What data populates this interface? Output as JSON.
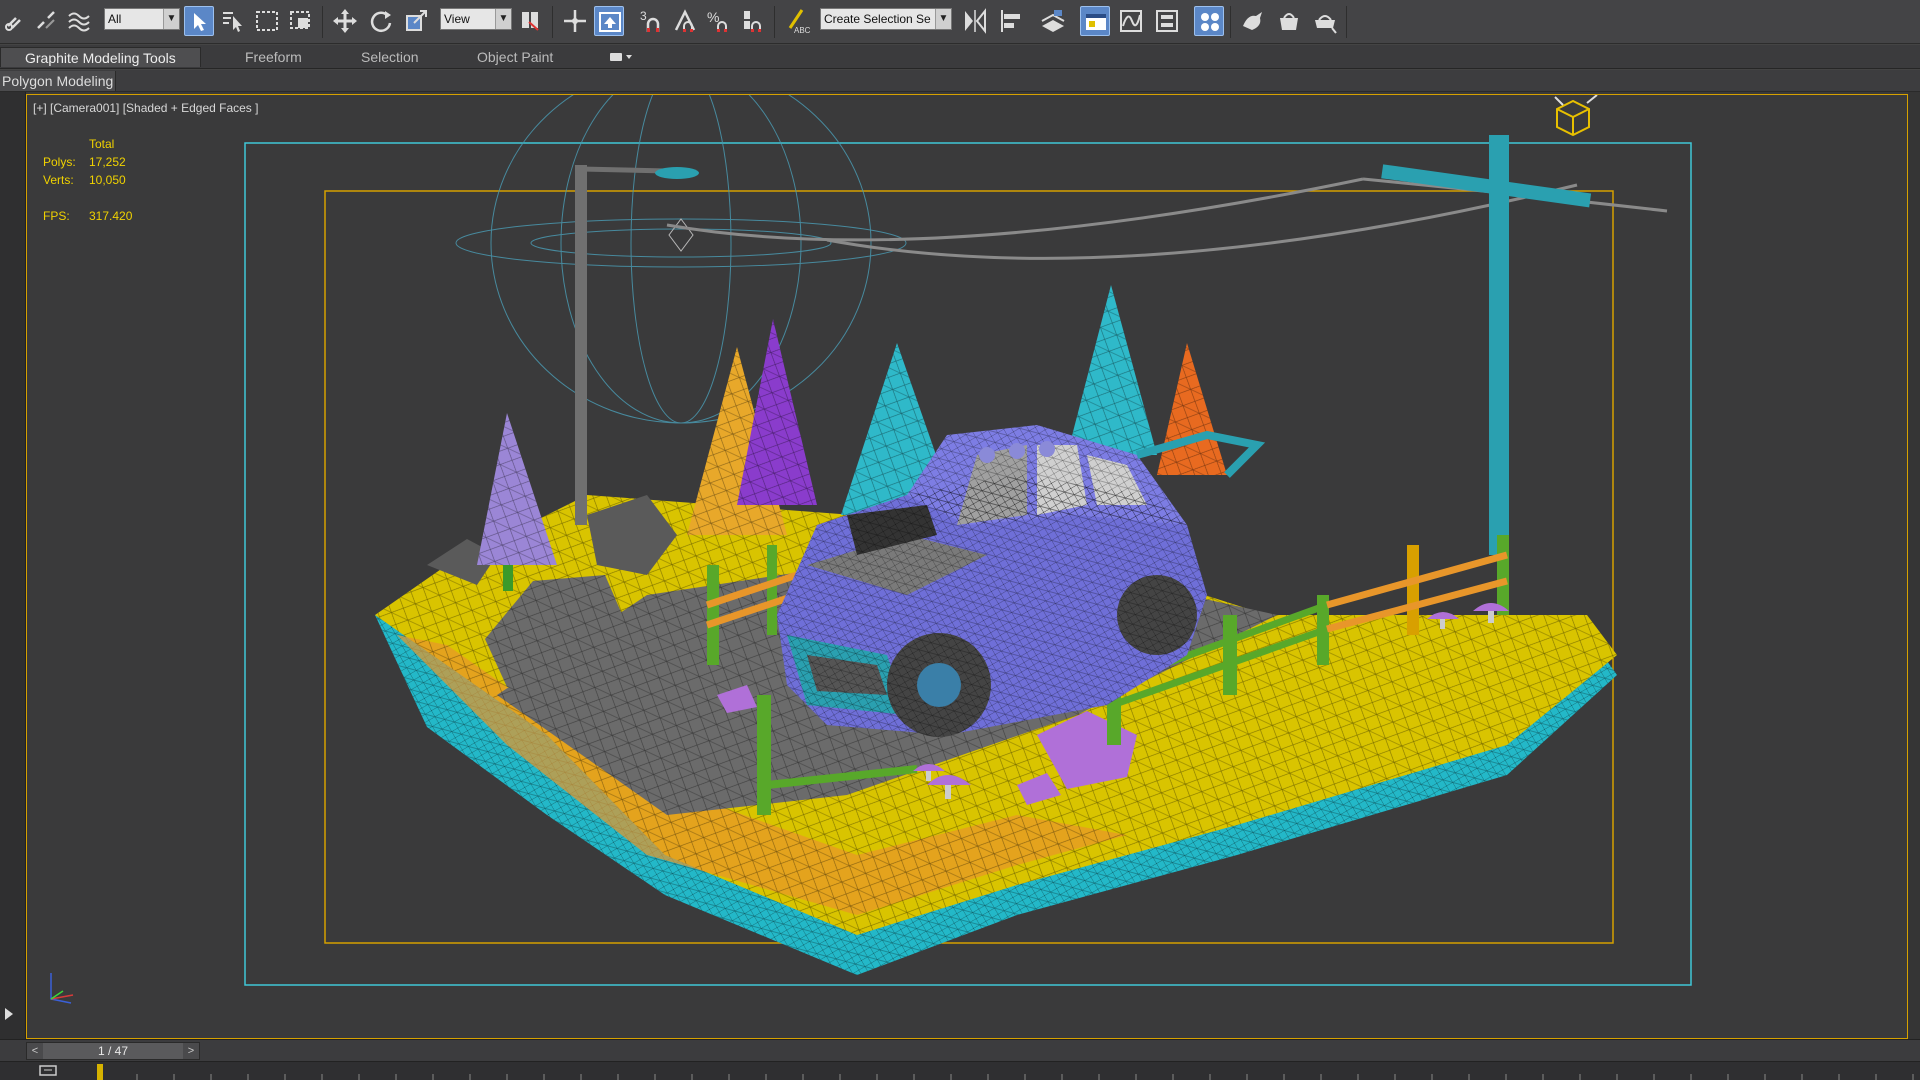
{
  "toolbar": {
    "selection_filter": "All",
    "reference_coord": "View",
    "snap_label": "3",
    "named_selection": "Create Selection Se",
    "angle_snap_label": "A",
    "percent_snap_label": "%"
  },
  "ribbon": {
    "tabs": [
      {
        "label": "Graphite Modeling Tools",
        "active": true
      },
      {
        "label": "Freeform",
        "active": false
      },
      {
        "label": "Selection",
        "active": false
      },
      {
        "label": "Object Paint",
        "active": false
      }
    ],
    "sub_tab": "Polygon Modeling"
  },
  "viewport": {
    "label": "[+] [Camera001] [Shaded + Edged Faces ]",
    "stats": {
      "header": "Total",
      "polys_label": "Polys:",
      "polys_value": "17,252",
      "verts_label": "Verts:",
      "verts_value": "10,050",
      "fps_label": "FPS:",
      "fps_value": "317.420"
    },
    "axis": {
      "z": "z",
      "x": "x",
      "y": "y"
    }
  },
  "timeline": {
    "frame": "1 / 47",
    "prev": "<",
    "next": ">"
  },
  "colors": {
    "viewport_border": "#d6a100",
    "safe_frame_cyan": "#3fc8d8",
    "safe_frame_gold": "#d4a000",
    "ground_yellow": "#d9c400",
    "ground_cyan": "#23b8c8",
    "car_purple": "#6f6fd8",
    "tree_teal": "#2fb9c9",
    "tree_purple": "#8a3ccc",
    "tree_orange": "#e8962a",
    "fence_green": "#58a82a"
  }
}
